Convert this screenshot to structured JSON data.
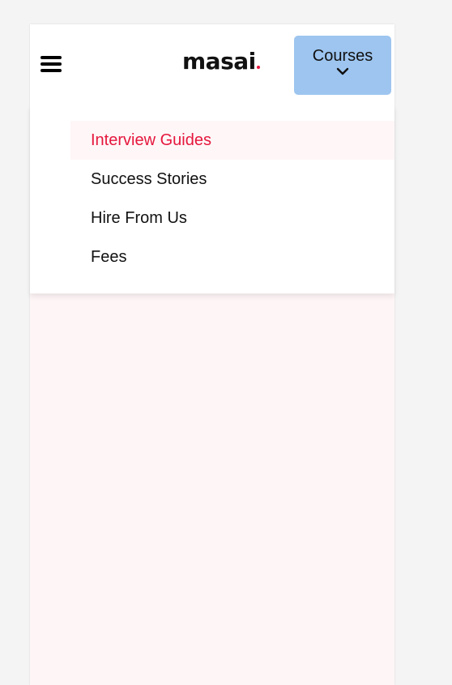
{
  "header": {
    "logo_text": "masai",
    "courses_label": "Courses"
  },
  "menu": {
    "items": [
      {
        "label": "Interview Guides",
        "active": true
      },
      {
        "label": "Success Stories",
        "active": false
      },
      {
        "label": "Hire From Us",
        "active": false
      },
      {
        "label": "Fees",
        "active": false
      }
    ]
  },
  "colors": {
    "accent_red": "#e5173d",
    "courses_button_bg": "#9dc5ef",
    "text": "#111111",
    "content_bg": "#fef5f6"
  },
  "icons": {
    "menu": "hamburger-icon",
    "dropdown": "chevron-down-icon"
  }
}
